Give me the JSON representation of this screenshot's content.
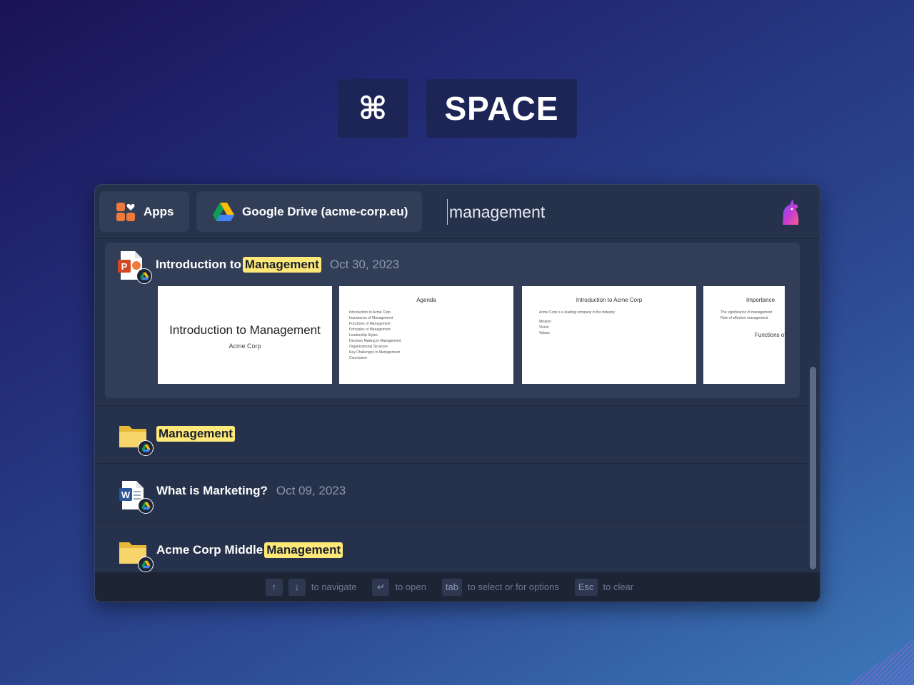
{
  "shortcut": {
    "modifier": "⌘",
    "key": "SPACE"
  },
  "sources": [
    {
      "label": "Apps",
      "icon": "apps-icon"
    },
    {
      "label": "Google Drive (acme-corp.eu)",
      "icon": "google-drive-icon"
    }
  ],
  "search": {
    "value": "management"
  },
  "results": [
    {
      "type": "powerpoint",
      "title_pre": "Introduction to",
      "title_hl": "Management",
      "date": "Oct 30, 2023",
      "slides": [
        {
          "title": "Introduction to Management",
          "subtitle": "Acme Corp"
        },
        {
          "heading": "Agenda",
          "items": [
            "Introduction to Acme Corp",
            "Importance of Management",
            "Functions of Management",
            "Principles of Management",
            "Leadership Styles",
            "Decision Making in Management",
            "Organizational Structure",
            "Key Challenges in Management",
            "Conclusion"
          ]
        },
        {
          "heading": "Introduction to Acme Corp",
          "body": "Acme Corp is a leading company in the industry",
          "items": [
            "Mission",
            "Vision",
            "Values"
          ]
        },
        {
          "heading": "Importance",
          "sub": "Functions of",
          "items": [
            "The significance of management",
            "Role of effective management"
          ]
        }
      ]
    },
    {
      "type": "folder",
      "title_pre": "",
      "title_hl": "Management",
      "date": ""
    },
    {
      "type": "word",
      "title_pre": "What is Marketing?",
      "title_hl": "",
      "date": "Oct 09, 2023"
    },
    {
      "type": "folder",
      "title_pre": "Acme Corp Middle",
      "title_hl": "Management",
      "date": ""
    }
  ],
  "footer": {
    "navigate": "to navigate",
    "enter_key": "↵",
    "open": "to open",
    "tab_key": "tab",
    "select": "to select or for options",
    "esc_key": "Esc",
    "clear": "to clear",
    "up_key": "↑",
    "down_key": "↓"
  }
}
